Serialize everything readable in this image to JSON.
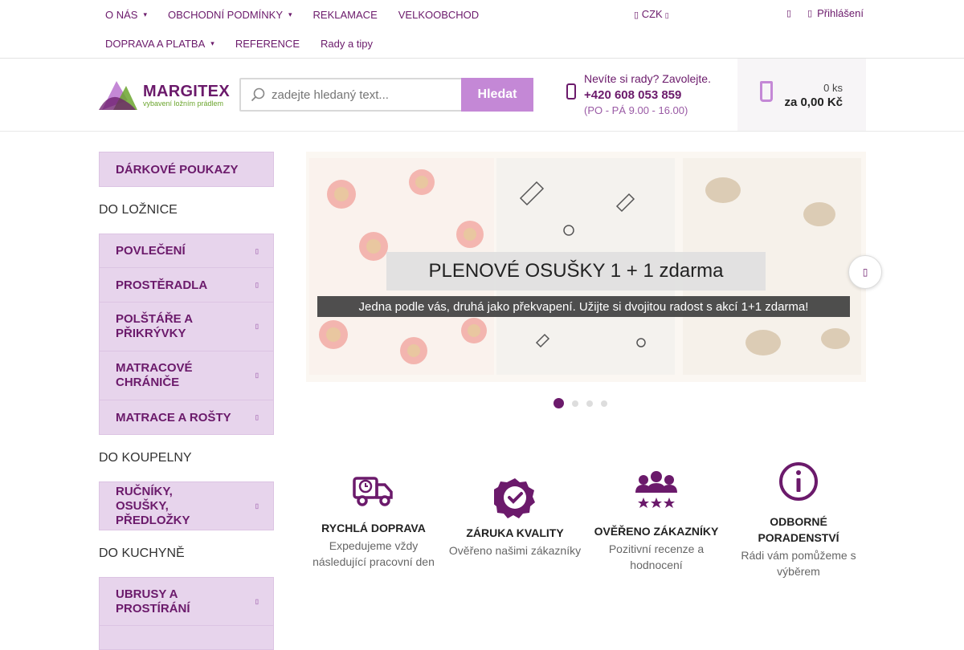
{
  "topnav": {
    "row1": [
      {
        "label": "O NÁS",
        "dropdown": true
      },
      {
        "label": "OBCHODNÍ PODMÍNKY",
        "dropdown": true
      },
      {
        "label": "REKLAMACE",
        "dropdown": false
      },
      {
        "label": "VELKOOBCHOD",
        "dropdown": false
      }
    ],
    "row2": [
      {
        "label": "DOPRAVA A PLATBA",
        "dropdown": true
      },
      {
        "label": "REFERENCE",
        "dropdown": false
      },
      {
        "label": "Rady a tipy",
        "dropdown": false
      }
    ],
    "currency": "CZK",
    "login": "Přihlášení"
  },
  "header": {
    "logo_name": "MARGITEX",
    "logo_tagline": "vybavení ložním prádlem",
    "search_placeholder": "zadejte hledaný text...",
    "search_button": "Hledat",
    "contact_question": "Nevíte si rady? Zavolejte.",
    "contact_phone": "+420 608 053 859",
    "contact_hours": "(PO - PÁ 9.00 - 16.00)",
    "cart_qty": "0 ks",
    "cart_total": "za 0,00 Kč"
  },
  "sidebar": {
    "gift": "DÁRKOVÉ POUKAZY",
    "sections": [
      {
        "heading": "DO LOŽNICE",
        "items": [
          "POVLEČENÍ",
          "PROSTĚRADLA",
          "POLŠTÁŘE A PŘIKRÝVKY",
          "MATRACOVÉ CHRÁNIČE",
          "MATRACE A ROŠTY"
        ]
      },
      {
        "heading": "DO KOUPELNY",
        "items": [
          "RUČNÍKY, OSUŠKY, PŘEDLOŽKY"
        ]
      },
      {
        "heading": "DO KUCHYNĚ",
        "items": [
          "UBRUSY A PROSTÍRÁNÍ"
        ]
      }
    ]
  },
  "banner": {
    "title": "PLENOVÉ OSUŠKY 1 + 1 zdarma",
    "subtitle": "Jedna podle vás, druhá jako překvapení. Užijte si dvojitou radost s akcí 1+1 zdarma!",
    "slide_count": 4,
    "active_slide": 1
  },
  "features": [
    {
      "title": "RYCHLÁ DOPRAVA",
      "desc": "Expedujeme vždy následující pracovní den",
      "icon": "delivery-truck-icon"
    },
    {
      "title": "ZÁRUKA KVALITY",
      "desc": "Ověřeno našimi zákazníky",
      "icon": "quality-check-icon"
    },
    {
      "title": "OVĚŘENO ZÁKAZNÍKY",
      "desc": "Pozitivní recenze a hodnocení",
      "icon": "customers-rating-icon"
    },
    {
      "title": "ODBORNÉ PORADENSTVÍ",
      "desc": "Rádi vám pomůžeme s výběrem",
      "icon": "info-icon"
    }
  ],
  "colors": {
    "brand": "#6b1a6b",
    "accent": "#c488d6",
    "sidebar_bg": "#e7d4ec"
  }
}
